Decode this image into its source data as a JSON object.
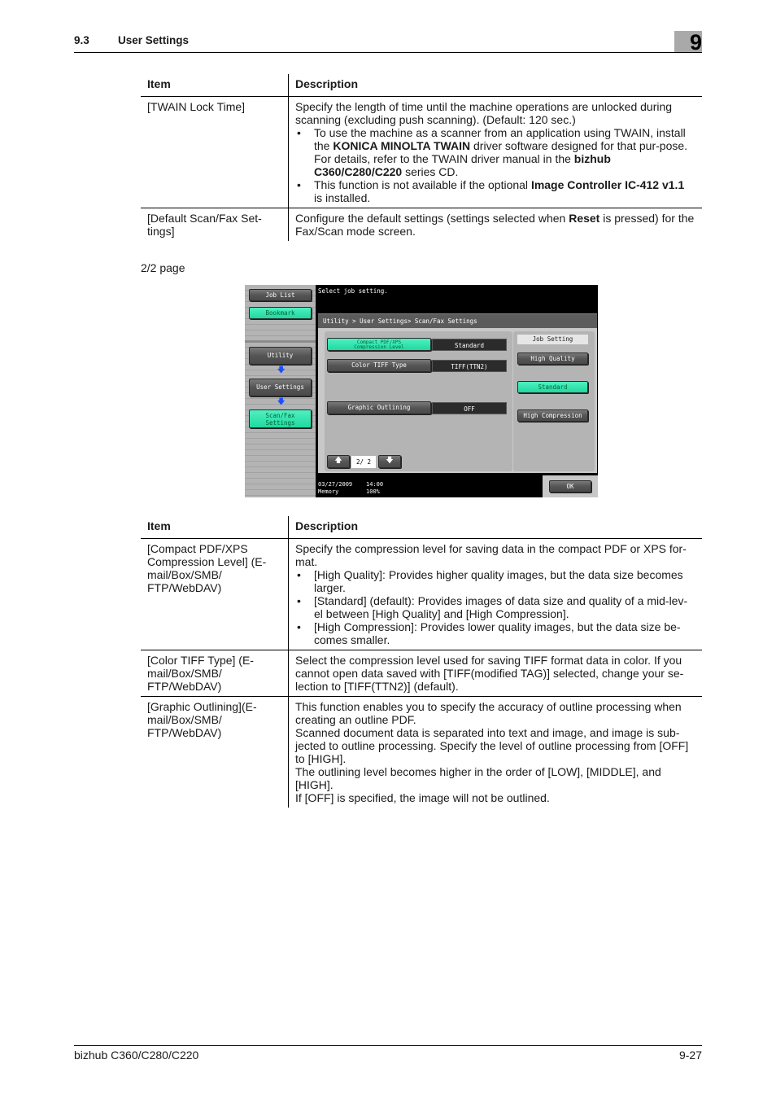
{
  "header": {
    "section_number": "9.3",
    "section_title": "User Settings",
    "chapter": "9"
  },
  "table1": {
    "headers": {
      "item": "Item",
      "description": "Description"
    },
    "rows": [
      {
        "item": "[TWAIN Lock Time]",
        "intro": "Specify the length of time until the machine operations are unlocked during scanning (excluding push scanning). (Default: 120 sec.)",
        "bullets": [
          {
            "parts": [
              {
                "t": "To use the machine as a scanner from an application using TWAIN, install the ",
                "b": false
              },
              {
                "t": "KONICA MINOLTA TWAIN",
                "b": true
              },
              {
                "t": " driver software designed for that pur-pose. For details, refer to the TWAIN driver manual in the ",
                "b": false
              },
              {
                "t": "bizhub C360/C280/C220",
                "b": true
              },
              {
                "t": " series CD.",
                "b": false
              }
            ]
          },
          {
            "parts": [
              {
                "t": "This function is not available if the optional ",
                "b": false
              },
              {
                "t": "Image Controller IC-412 v1.1",
                "b": true
              },
              {
                "t": " is installed.",
                "b": false
              }
            ]
          }
        ]
      },
      {
        "item": "[Default Scan/Fax Set-tings]",
        "intro_parts": [
          {
            "t": "Configure the default settings (settings selected when ",
            "b": false
          },
          {
            "t": "Reset",
            "b": true
          },
          {
            "t": " is pressed) for the Fax/Scan mode screen.",
            "b": false
          }
        ]
      }
    ]
  },
  "caption": "2/2 page",
  "panel": {
    "message": "Select job setting.",
    "breadcrumb": "Utility > User Settings> Scan/Fax Settings",
    "side": {
      "job_list": "Job List",
      "bookmark": "Bookmark",
      "utility": "Utility",
      "user_settings": "User Settings",
      "scan_fax_settings_1": "Scan/Fax",
      "scan_fax_settings_2": "Settings"
    },
    "settings": [
      {
        "label1": "Compact PDF/XPS",
        "label2": "Compression Level",
        "value": "Standard",
        "selected": true
      },
      {
        "label1": "Color TIFF Type",
        "label2": "",
        "value": "TIFF(TTN2)",
        "selected": false
      },
      {
        "label1": "Graphic Outlining",
        "label2": "",
        "value": "OFF",
        "selected": false
      }
    ],
    "page_indicator": "2/ 2",
    "job_setting": {
      "label": "Job Setting",
      "options": [
        {
          "label": "High Quality",
          "selected": false
        },
        {
          "label": "Standard",
          "selected": true
        },
        {
          "label": "High Compression",
          "selected": false
        }
      ]
    },
    "status": {
      "date": "03/27/2009",
      "time": "14:00",
      "memory_label": "Memory",
      "memory_value": "100%"
    },
    "ok": "OK",
    "colors": {
      "selected": "#2ee0aa",
      "arrow": "#1a4fff"
    }
  },
  "table2": {
    "headers": {
      "item": "Item",
      "description": "Description"
    },
    "rows": [
      {
        "item": "[Compact PDF/XPS Compression Level] (E-mail/Box/SMB/ FTP/WebDAV)",
        "intro": "Specify the compression level for saving data in the compact PDF or XPS for-mat.",
        "bullets": [
          "[High Quality]: Provides higher quality images, but the data size becomes larger.",
          "[Standard] (default): Provides images of data size and quality of a mid-lev-el between [High Quality] and [High Compression].",
          "[High Compression]: Provides lower quality images, but the data size be-comes smaller."
        ]
      },
      {
        "item": "[Color TIFF Type] (E-mail/Box/SMB/ FTP/WebDAV)",
        "intro": "Select the compression level used for saving TIFF format data in color. If you cannot open data saved with [TIFF(modified TAG)] selected, change your se-lection to [TIFF(TTN2)] (default)."
      },
      {
        "item": "[Graphic Outlining](E-mail/Box/SMB/ FTP/WebDAV)",
        "lines": [
          "This function enables you to specify the accuracy of outline processing when creating an outline PDF.",
          "Scanned document data is separated into text and image, and image is sub-jected to outline processing. Specify the level of outline processing from [OFF] to [HIGH].",
          "The outlining level becomes higher in the order of [LOW], [MIDDLE], and [HIGH].",
          "If [OFF] is specified, the image will not be outlined."
        ]
      }
    ]
  },
  "footer": {
    "product": "bizhub C360/C280/C220",
    "page": "9-27"
  }
}
